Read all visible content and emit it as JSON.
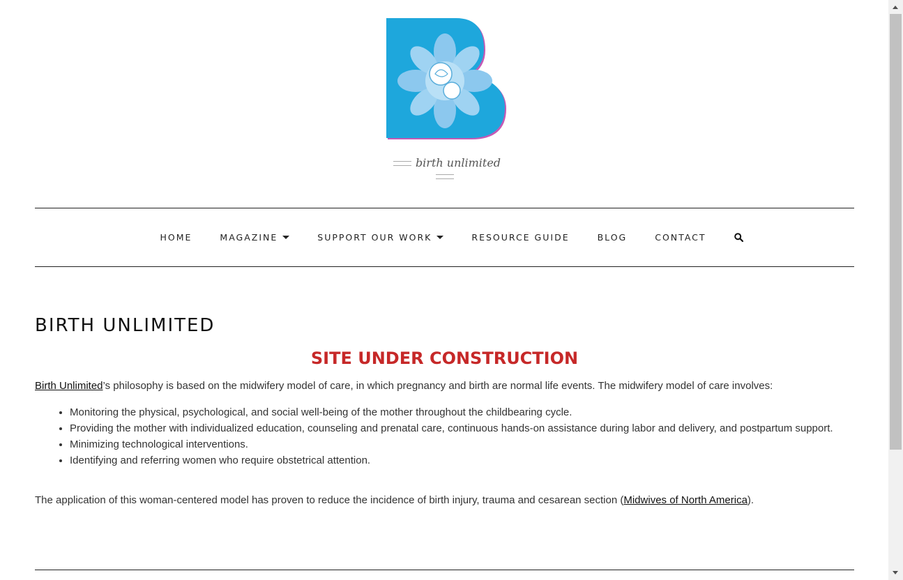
{
  "logo": {
    "letter": "B",
    "caption": "birth unlimited",
    "colors": {
      "primary": "#1ea7dc",
      "flower": "#8cc8ee",
      "accent": "#c45ab5"
    }
  },
  "nav": {
    "items": [
      {
        "label": "HOME",
        "dropdown": false
      },
      {
        "label": "MAGAZINE",
        "dropdown": true
      },
      {
        "label": "SUPPORT OUR WORK",
        "dropdown": true
      },
      {
        "label": "RESOURCE GUIDE",
        "dropdown": false
      },
      {
        "label": "BLOG",
        "dropdown": false
      },
      {
        "label": "CONTACT",
        "dropdown": false
      }
    ],
    "search_icon": "search-icon"
  },
  "content": {
    "page_title": "BIRTH UNLIMITED",
    "headline": "SITE UNDER CONSTRUCTION",
    "headline_color": "#c62828",
    "intro_link": "Birth Unlimited",
    "intro_text": "’s philosophy is based on the midwifery model of care, in which pregnancy and birth are normal life events. The midwifery model of care involves:",
    "bullets": [
      "Monitoring the physical, psychological, and social well-being of the mother throughout the childbearing cycle.",
      "Providing the mother with individualized education, counseling and prenatal care, continuous hands-on assistance during labor and delivery, and postpartum support.",
      "Minimizing technological interventions.",
      "Identifying and referring women who require obstetrical attention."
    ],
    "outro_text": "The application of this woman-centered model has proven to reduce the incidence of birth injury, trauma and cesarean section (",
    "outro_link": "Midwives of North America",
    "outro_end": ")."
  }
}
